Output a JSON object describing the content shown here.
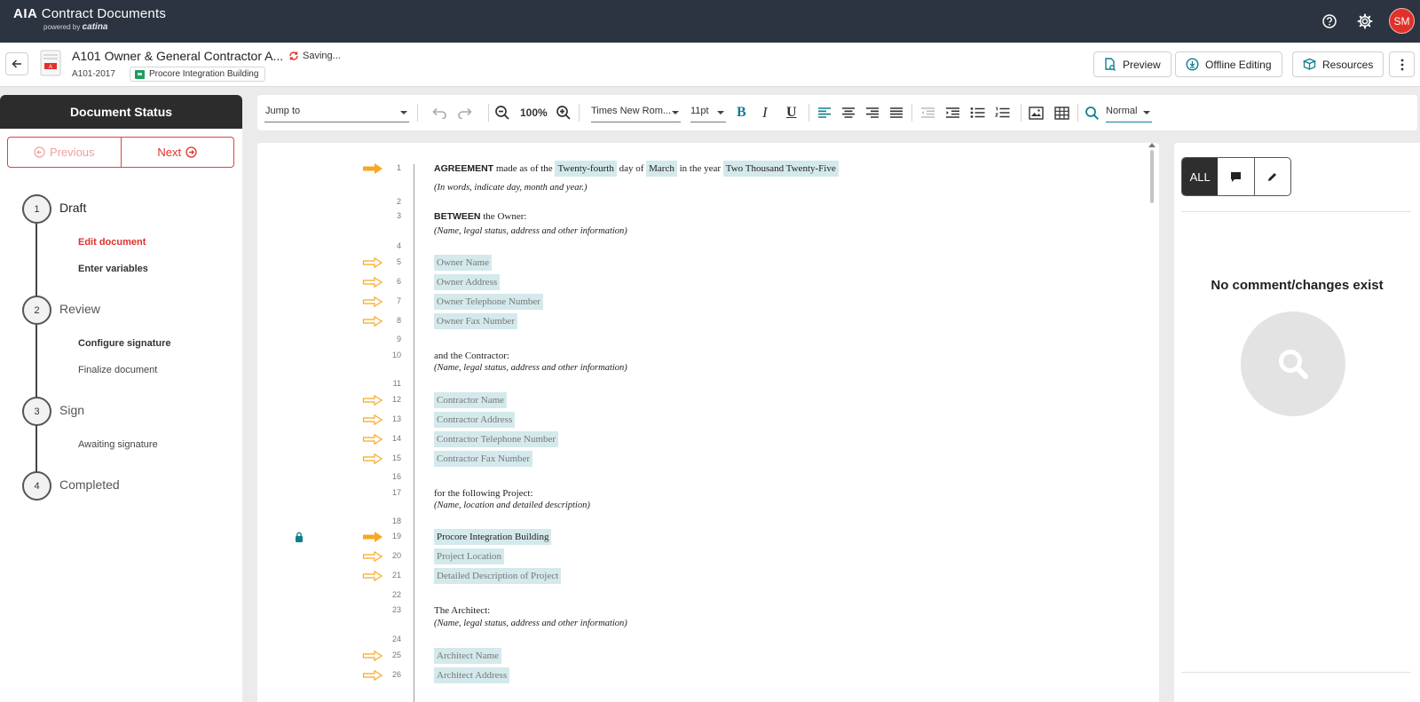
{
  "topbar": {
    "brand_bold": "AIA",
    "brand_rest": " Contract Documents",
    "powered_by": "powered by",
    "powered_brand": "catina",
    "avatar_initials": "SM"
  },
  "doc_header": {
    "title": "A101 Owner & General Contractor A...",
    "status": "Saving...",
    "code": "A101-2017",
    "project": "Procore Integration Building",
    "buttons": {
      "preview": "Preview",
      "offline": "Offline Editing",
      "resources": "Resources"
    }
  },
  "status_panel": {
    "title": "Document Status",
    "previous": "Previous",
    "next": "Next",
    "steps": [
      {
        "number": "1",
        "title": "Draft",
        "items": [
          "Edit document",
          "Enter variables"
        ]
      },
      {
        "number": "2",
        "title": "Review",
        "items": [
          "Configure signature",
          "Finalize document"
        ]
      },
      {
        "number": "3",
        "title": "Sign",
        "items": [
          "Awaiting signature"
        ]
      },
      {
        "number": "4",
        "title": "Completed",
        "items": []
      }
    ]
  },
  "toolbar": {
    "jump_to": "Jump to",
    "zoom": "100%",
    "font_family": "Times New Rom...",
    "font_size": "11pt",
    "bold": "B",
    "italic": "I",
    "underline": "U",
    "style": "Normal"
  },
  "document": {
    "line_numbers": [
      "1",
      "2",
      "3",
      "4",
      "5",
      "6",
      "7",
      "8",
      "9",
      "10",
      "11",
      "12",
      "13",
      "14",
      "15",
      "16",
      "17",
      "18",
      "19",
      "20",
      "21",
      "22",
      "23",
      "24",
      "25",
      "26"
    ],
    "l1": {
      "bold": "AGREEMENT",
      "t1": " made as of the ",
      "v1": "Twenty-fourth",
      "t2": " day of ",
      "v2": "March",
      "t3": " in the year ",
      "v3": "Two Thousand Twenty-Five"
    },
    "l1_hint": "(In words, indicate day, month and year.)",
    "l3": {
      "bold": "BETWEEN",
      "t1": " the Owner:"
    },
    "l3_hint": "(Name, legal status, address and other information)",
    "owner_vars": [
      "Owner Name",
      "Owner Address",
      "Owner Telephone Number",
      "Owner Fax Number"
    ],
    "l10": "and the Contractor:",
    "l10_hint": "(Name, legal status, address and other information)",
    "contractor_vars": [
      "Contractor Name",
      "Contractor Address",
      "Contractor Telephone Number",
      "Contractor Fax Number"
    ],
    "l17": "for the following Project:",
    "l17_hint": "(Name, location and detailed description)",
    "project_vars": [
      "Procore Integration Building",
      "Project Location",
      "Detailed Description of Project"
    ],
    "l23": "The Architect:",
    "l23_hint": "(Name, legal status, address and other information)",
    "architect_vars": [
      "Architect Name",
      "Architect Address"
    ]
  },
  "comments_panel": {
    "filter_all": "ALL",
    "empty_message": "No comment/changes exist"
  },
  "colors": {
    "topbar": "#2b3440",
    "accent_red": "#e0312b",
    "arrow": "#f7a823",
    "variable_bg": "#d4e9ec",
    "teal_icon": "#0f7f8c"
  }
}
